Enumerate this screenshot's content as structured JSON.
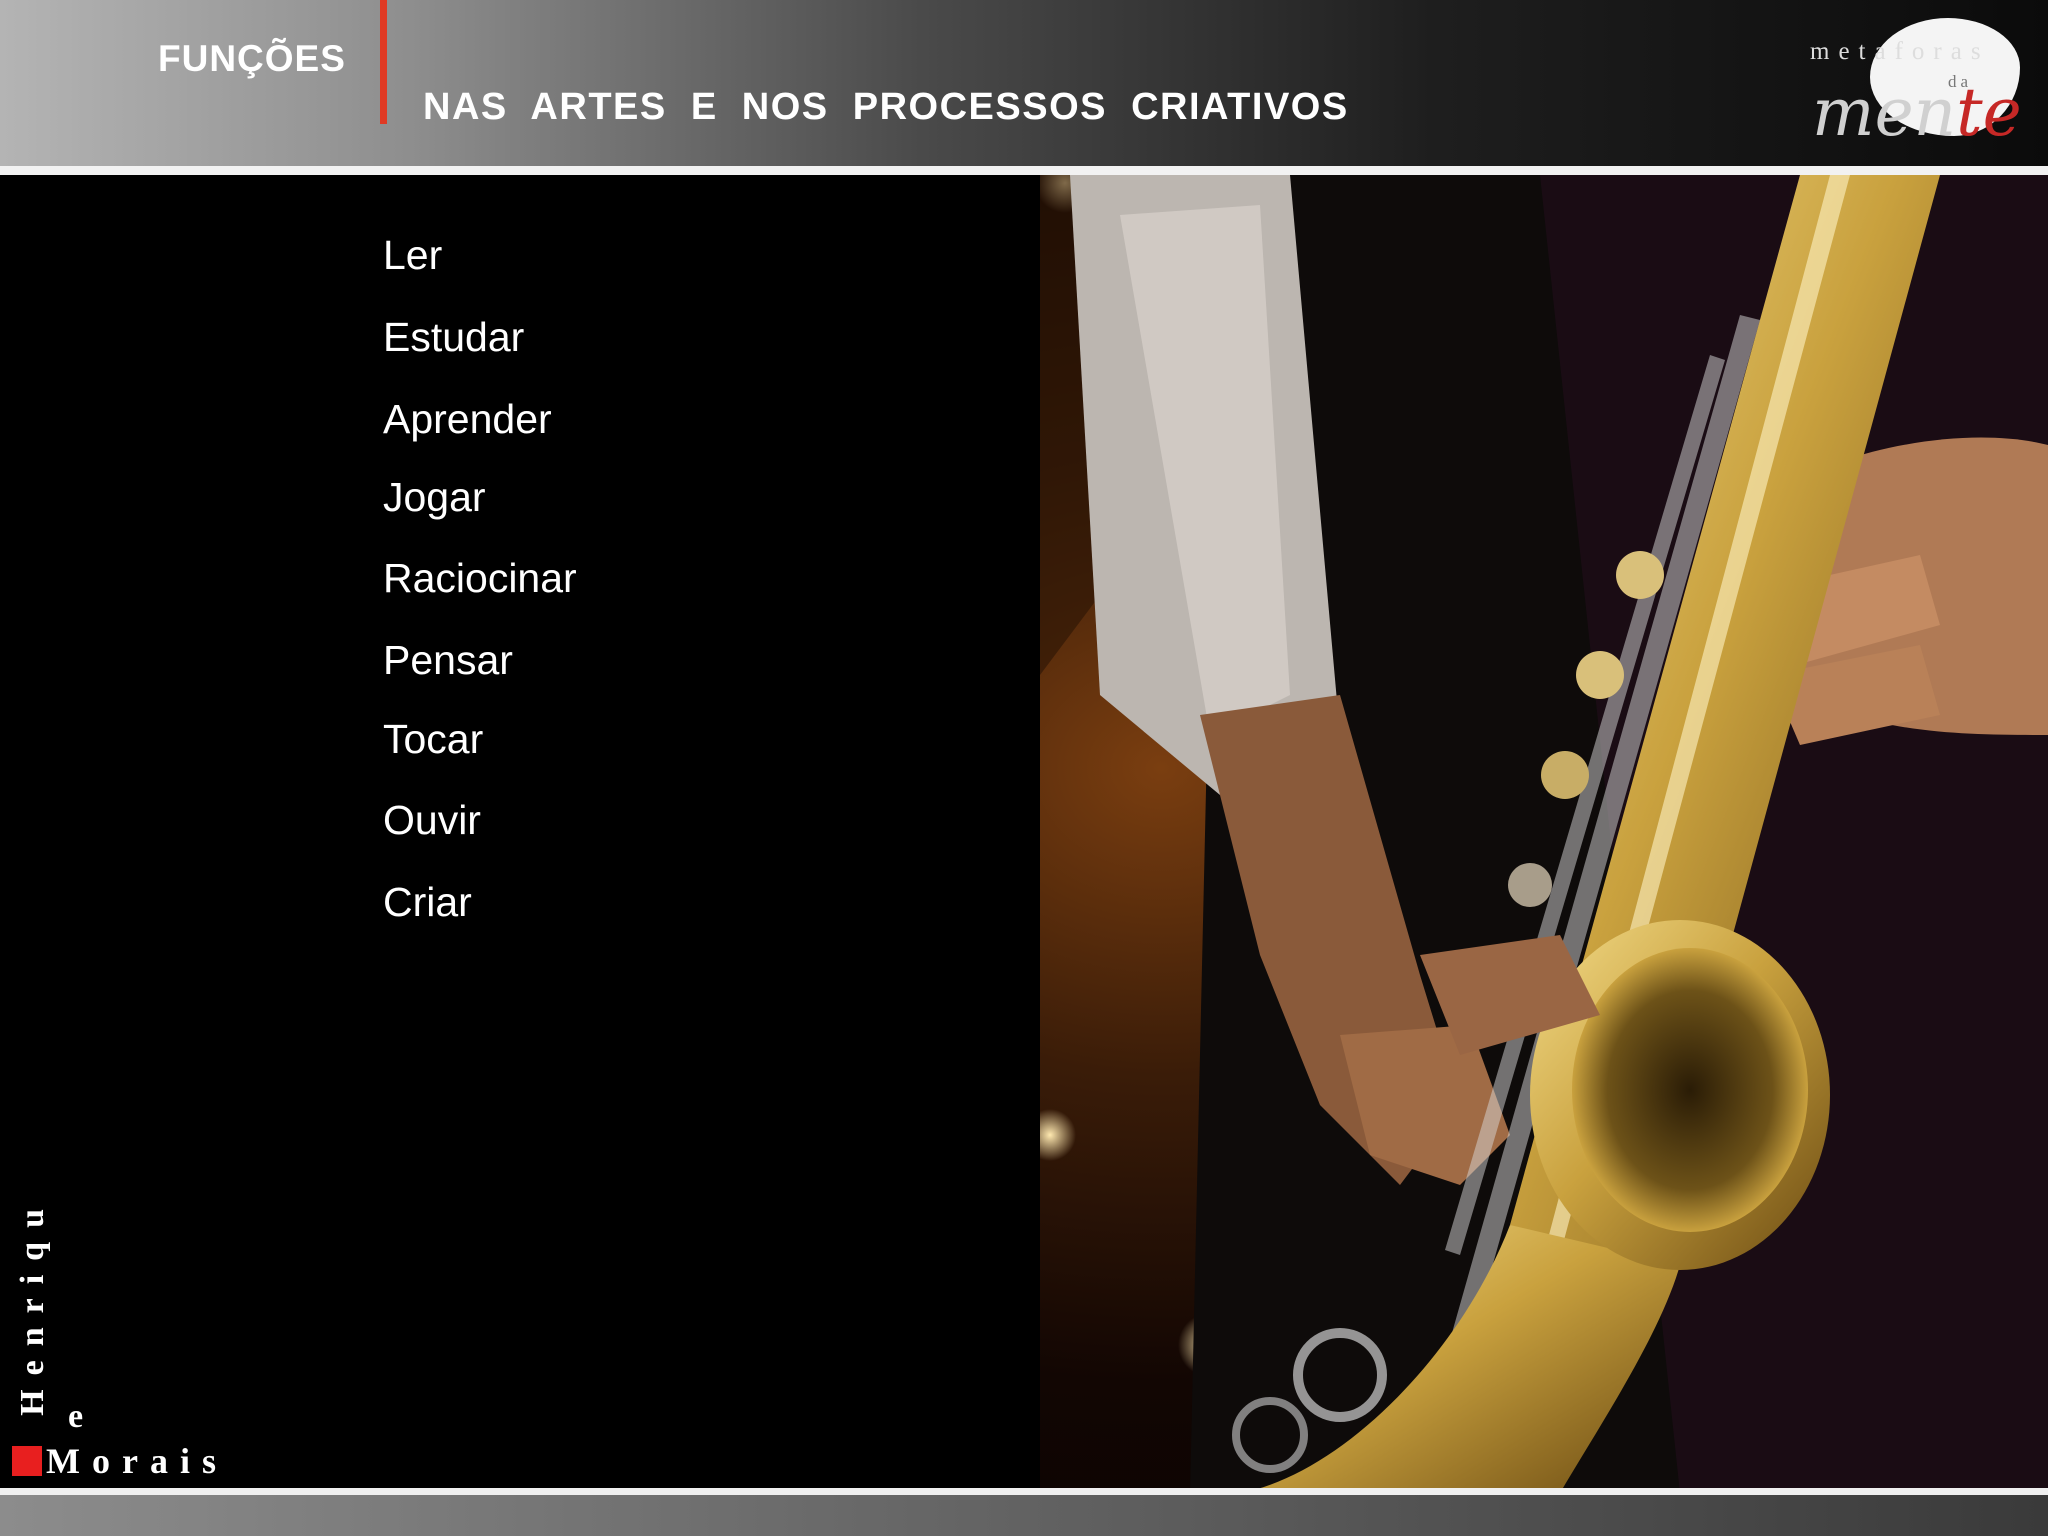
{
  "header": {
    "title": "FUNÇÕES",
    "subtitle": "NAS  ARTES  E  NOS  PROCESSOS  CRIATIVOS"
  },
  "logo": {
    "top_text": "metaforas",
    "middle_text": "da",
    "main_text_prefix": "men",
    "main_text_suffix": "te"
  },
  "list": {
    "items": [
      "Ler",
      "Estudar",
      "Aprender",
      "Jogar",
      "Raciocinar",
      "Pensar",
      "Tocar",
      "Ouvir",
      "Criar"
    ]
  },
  "author": {
    "vertical": "Henriqu",
    "e": "e",
    "last": "Morais"
  },
  "image": {
    "subject": "saxophone-player"
  },
  "colors": {
    "accent": "#e03a24",
    "author_square": "#e81f1f",
    "brass": "#c9a13e"
  }
}
